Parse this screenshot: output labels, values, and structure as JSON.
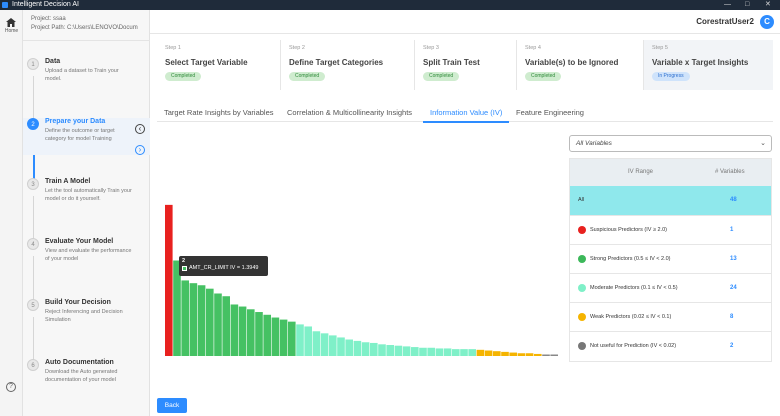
{
  "app": {
    "title": "Intelligent Decision AI",
    "controls": [
      "—",
      "□",
      "✕"
    ]
  },
  "rail": {
    "home_label": "Home",
    "help_glyph": "?"
  },
  "project": {
    "name_label": "Project:",
    "name": "ssaa",
    "path_label": "Project Path:",
    "path": "C:\\Users\\LENOVO\\Docum"
  },
  "steps": [
    {
      "num": "1",
      "title": "Data",
      "desc": "Upload a dataset to Train your model."
    },
    {
      "num": "2",
      "title": "Prepare your Data",
      "desc": "Define the outcome or target category for model Training"
    },
    {
      "num": "3",
      "title": "Train A Model",
      "desc": "Let the tool automatically Train your model or do it yourself."
    },
    {
      "num": "4",
      "title": "Evaluate Your Model",
      "desc": "View and evaluate the performance of your model"
    },
    {
      "num": "5",
      "title": "Build Your Decision",
      "desc": "Reject Inferencing and Decision Simulation"
    },
    {
      "num": "6",
      "title": "Auto Documentation",
      "desc": "Download the Auto generated documentation of your model"
    }
  ],
  "user": {
    "name": "CorestratUser2",
    "initial": "C"
  },
  "wizard": [
    {
      "step": "Step 1",
      "title": "Select Target Variable",
      "status": "Completed"
    },
    {
      "step": "Step 2",
      "title": "Define Target Categories",
      "status": "Completed"
    },
    {
      "step": "Step 3",
      "title": "Split Train Test",
      "status": "Completed"
    },
    {
      "step": "Step 4",
      "title": "Variable(s) to be Ignored",
      "status": "Completed"
    },
    {
      "step": "Step 5",
      "title": "Variable x Target Insights",
      "status": "In Progress"
    }
  ],
  "tabs": [
    {
      "label": "Target Rate Insights by Variables"
    },
    {
      "label": "Correlation & Multicollinearity Insights"
    },
    {
      "label": "Information Value (IV)"
    },
    {
      "label": "Feature Engineering"
    }
  ],
  "filter": {
    "value": "All Variables"
  },
  "iv_table": {
    "col_range": "IV Range",
    "col_count": "# Variables",
    "rows": [
      {
        "label": "All",
        "count": "48",
        "color": ""
      },
      {
        "label": "Suspicious Predictors (IV ≥ 2.0)",
        "count": "1",
        "color": "#e8211f"
      },
      {
        "label": "Strong Predictors (0.5 ≤ IV < 2.0)",
        "count": "13",
        "color": "#3cb85a"
      },
      {
        "label": "Moderate Predictors (0.1 ≤ IV < 0.5)",
        "count": "24",
        "color": "#7ff0c8"
      },
      {
        "label": "Weak Predictors (0.02 ≤ IV < 0.1)",
        "count": "8",
        "color": "#f5b400"
      },
      {
        "label": "Not useful for Prediction (IV < 0.02)",
        "count": "2",
        "color": "#777777"
      }
    ]
  },
  "chart_data": {
    "type": "bar",
    "ylim": [
      0,
      2.3
    ],
    "colors": {
      "suspicious": "#e8211f",
      "strong": "#45c163",
      "moderate": "#7ff0c8",
      "weak": "#f5b400",
      "not_useful": "#888888"
    },
    "values": [
      2.2,
      1.39,
      1.1,
      1.06,
      1.03,
      0.98,
      0.91,
      0.87,
      0.75,
      0.72,
      0.68,
      0.64,
      0.6,
      0.56,
      0.53,
      0.5,
      0.46,
      0.43,
      0.36,
      0.33,
      0.3,
      0.27,
      0.24,
      0.22,
      0.2,
      0.19,
      0.17,
      0.16,
      0.15,
      0.14,
      0.13,
      0.12,
      0.12,
      0.11,
      0.11,
      0.1,
      0.1,
      0.1,
      0.09,
      0.08,
      0.07,
      0.06,
      0.05,
      0.04,
      0.04,
      0.03,
      0.015,
      0.01
    ],
    "tooltip": {
      "index": "2",
      "text": "AMT_CR_LIMIT IV = 1.3949"
    }
  },
  "back_label": "Back"
}
